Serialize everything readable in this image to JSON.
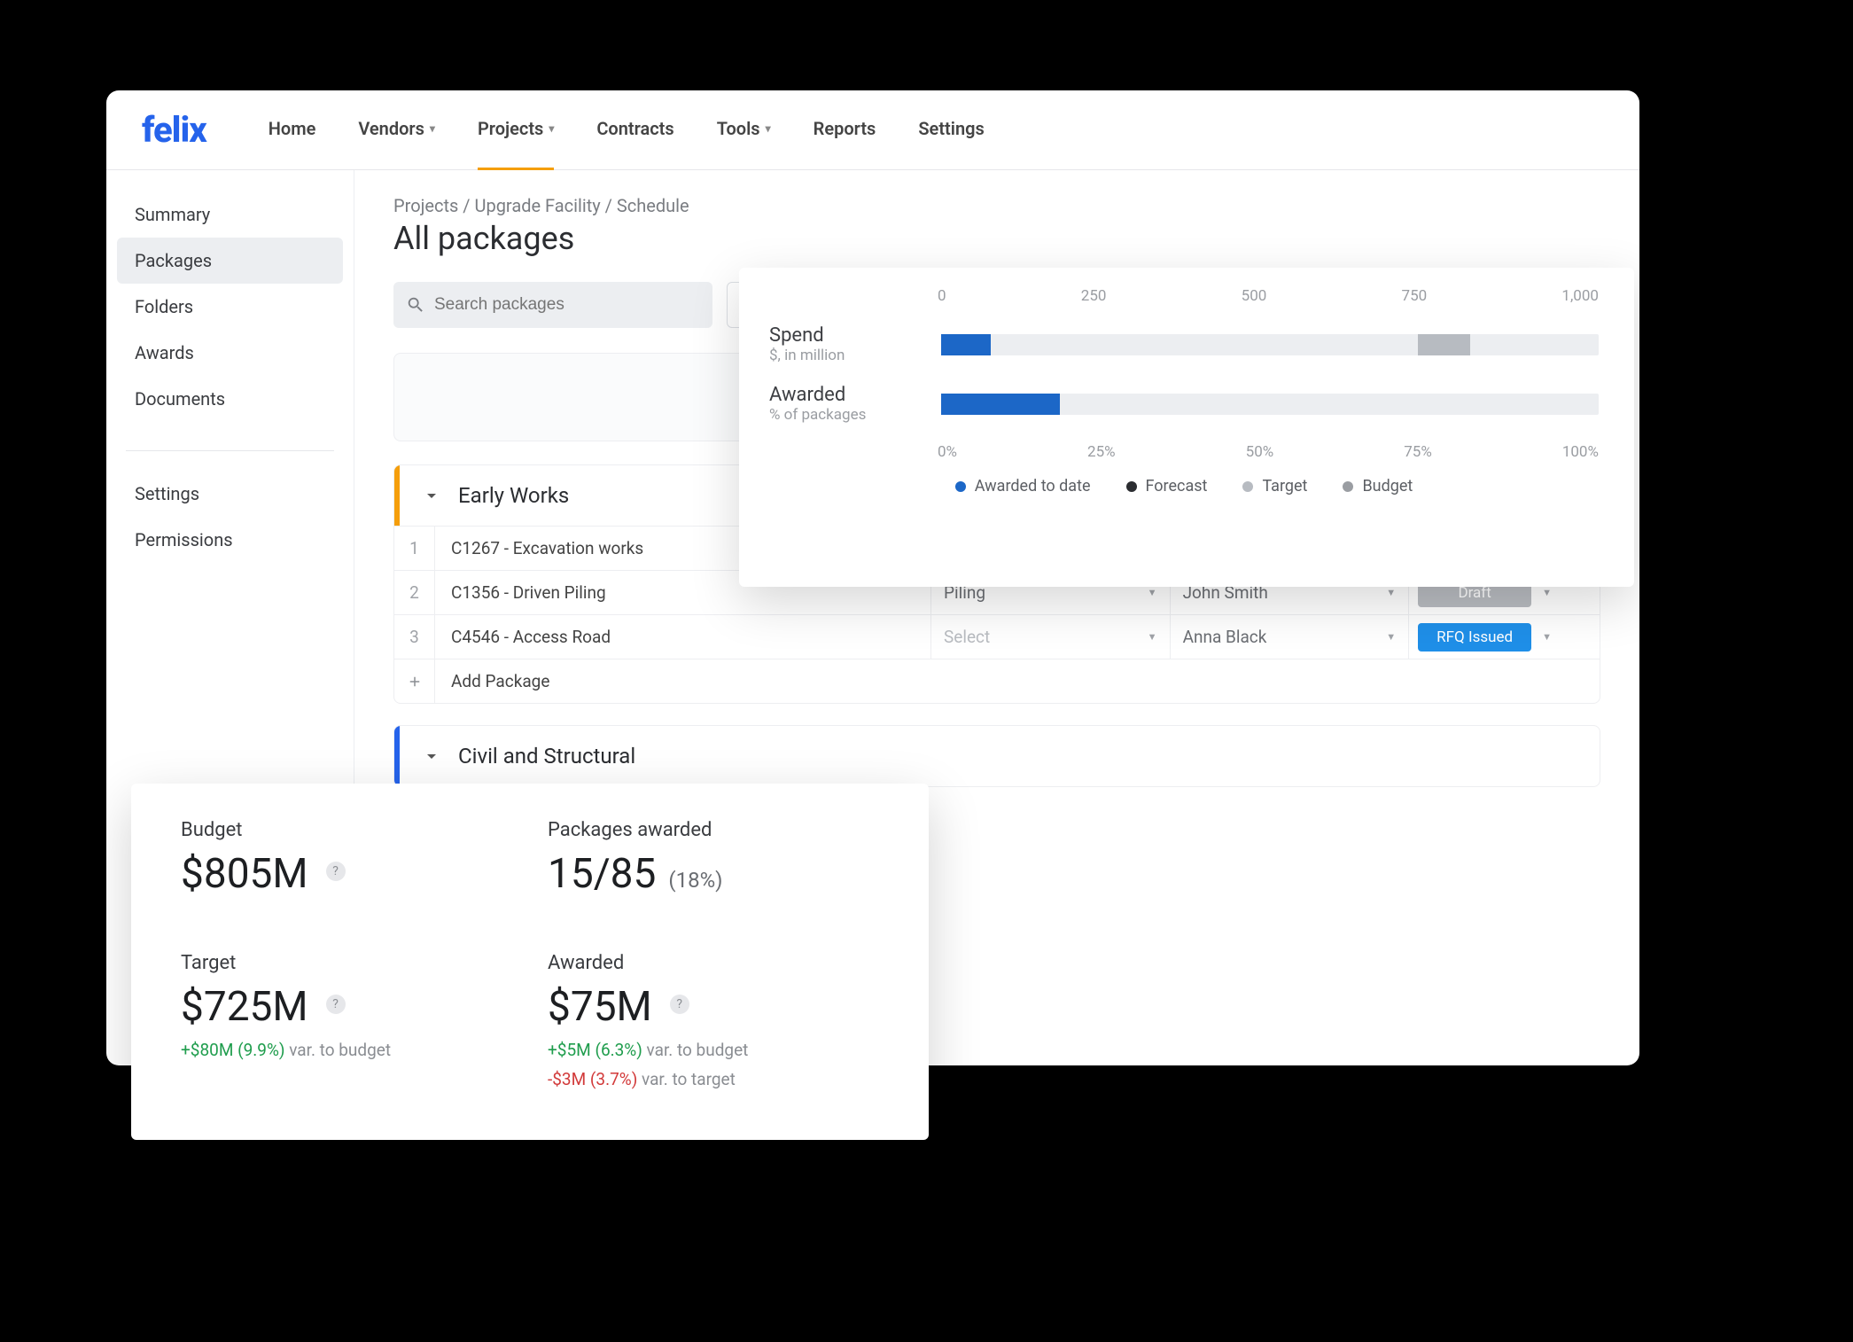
{
  "brand": "felix",
  "nav": {
    "home": "Home",
    "vendors": "Vendors",
    "projects": "Projects",
    "contracts": "Contracts",
    "tools": "Tools",
    "reports": "Reports",
    "settings": "Settings"
  },
  "sidebar": {
    "summary": "Summary",
    "packages": "Packages",
    "folders": "Folders",
    "awards": "Awards",
    "documents": "Documents",
    "settings": "Settings",
    "permissions": "Permissions"
  },
  "breadcrumb": "Projects / Upgrade Facility / Schedule",
  "page_title": "All packages",
  "search": {
    "placeholder": "Search packages"
  },
  "sections": {
    "early": {
      "title": "Early Works",
      "rows": [
        {
          "idx": "1",
          "name": "C1267 -  Excavation works",
          "discipline": "",
          "owner": "",
          "status": ""
        },
        {
          "idx": "2",
          "name": "C1356 - Driven Piling",
          "discipline": "Piling",
          "owner": "John Smith",
          "status": "Draft",
          "status_kind": "gray"
        },
        {
          "idx": "3",
          "name": "C4546 - Access Road",
          "discipline": "Select",
          "discipline_muted": true,
          "owner": "Anna Black",
          "status": "RFQ Issued",
          "status_kind": "blue"
        }
      ],
      "add": "Add Package"
    },
    "civil": {
      "title": "Civil and Structural"
    }
  },
  "chart_data": {
    "type": "bar",
    "legend": [
      "Awarded to date",
      "Forecast",
      "Target",
      "Budget"
    ],
    "spend": {
      "label": "Spend",
      "sublabel": "$, in million",
      "ticks": [
        "0",
        "250",
        "500",
        "750",
        "1,000"
      ],
      "range": [
        0,
        1000
      ],
      "awarded_to_date": 75,
      "target": 725,
      "budget": 805
    },
    "awarded": {
      "label": "Awarded",
      "sublabel": "% of packages",
      "ticks": [
        "0%",
        "25%",
        "50%",
        "75%",
        "100%"
      ],
      "range": [
        0,
        100
      ],
      "awarded_to_date_pct": 18
    }
  },
  "stats": {
    "budget": {
      "label": "Budget",
      "value": "$805M"
    },
    "packages_awarded": {
      "label": "Packages awarded",
      "value": "15/85",
      "pct": "(18%)"
    },
    "target": {
      "label": "Target",
      "value": "$725M",
      "var1": "+$80M (9.9%)",
      "var1_suffix": " var. to budget"
    },
    "awarded": {
      "label": "Awarded",
      "value": "$75M",
      "var1": "+$5M (6.3%)",
      "var1_suffix": " var. to budget",
      "var2": "-$3M (3.7%)",
      "var2_suffix": " var. to target"
    }
  }
}
